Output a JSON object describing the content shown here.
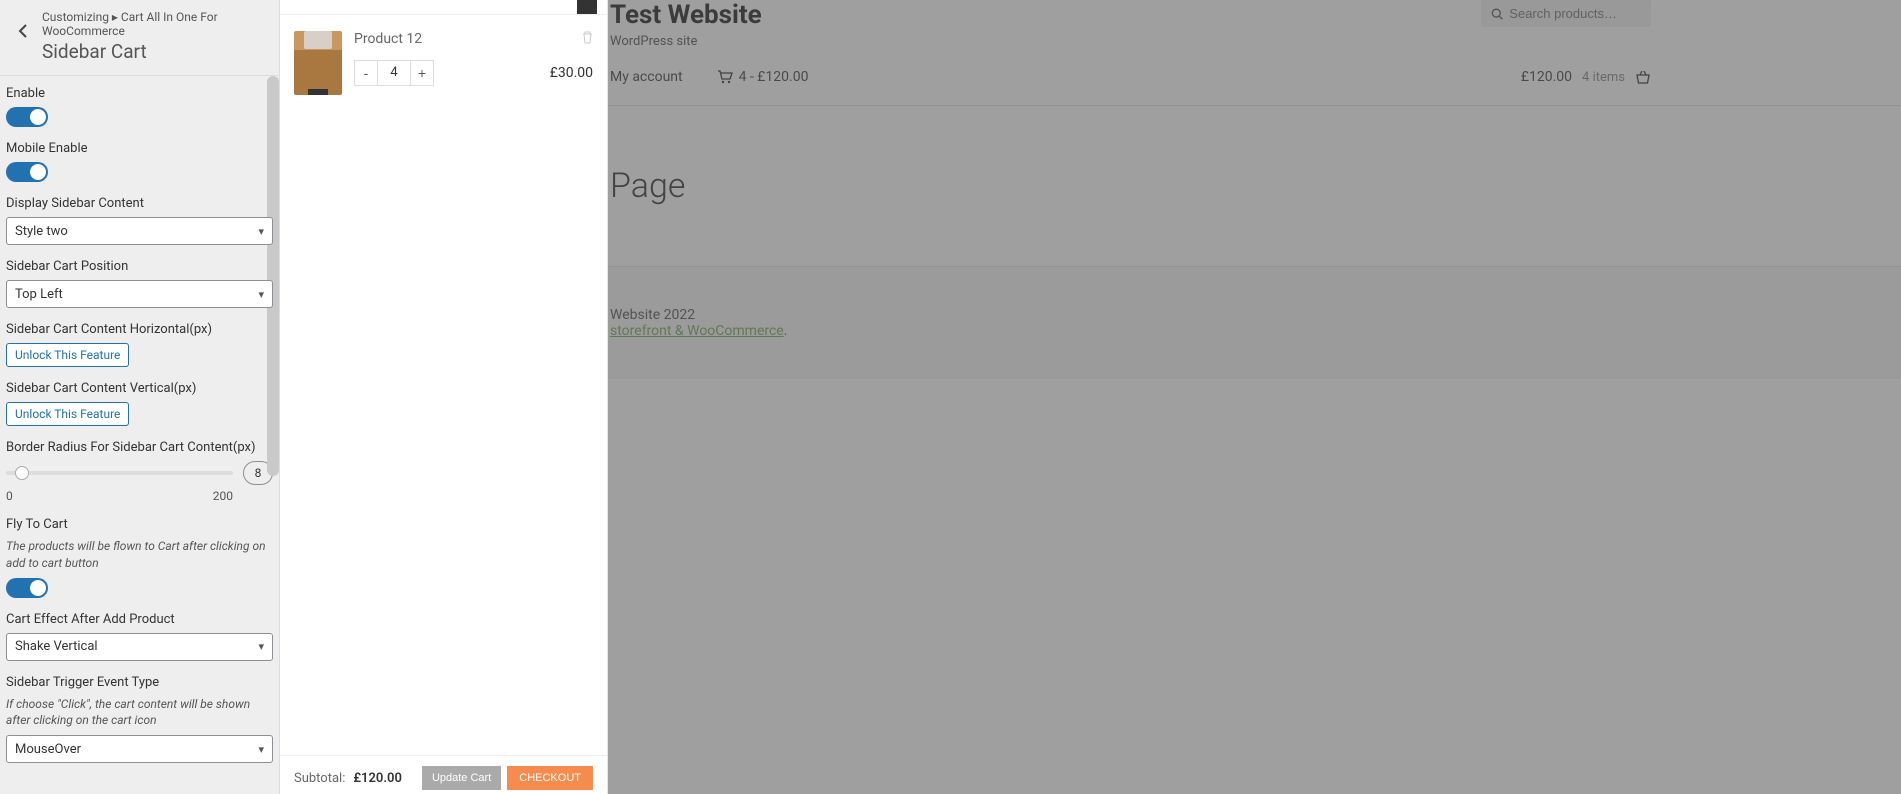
{
  "customizer": {
    "breadcrumb": "Customizing ▸ Cart All In One For WooCommerce",
    "title": "Sidebar Cart",
    "controls": {
      "enable": {
        "label": "Enable"
      },
      "mobile_enable": {
        "label": "Mobile Enable"
      },
      "display_sidebar_content": {
        "label": "Display Sidebar Content",
        "value": "Style two"
      },
      "sidebar_cart_position": {
        "label": "Sidebar Cart Position",
        "value": "Top Left"
      },
      "horizontal": {
        "label": "Sidebar Cart Content Horizontal(px)",
        "unlock": "Unlock This Feature"
      },
      "vertical": {
        "label": "Sidebar Cart Content Vertical(px)",
        "unlock": "Unlock This Feature"
      },
      "border_radius": {
        "label": "Border Radius For Sidebar Cart Content(px)",
        "value": "8",
        "min": "0",
        "max": "200"
      },
      "fly_to_cart": {
        "label": "Fly To Cart",
        "desc": "The products will be flown to Cart after clicking on add to cart button"
      },
      "cart_effect": {
        "label": "Cart Effect After Add Product",
        "value": "Shake Vertical"
      },
      "trigger": {
        "label": "Sidebar Trigger Event Type",
        "desc": "If choose \"Click\", the cart content will be shown after clicking on the cart icon",
        "value": "MouseOver"
      }
    }
  },
  "cart_panel": {
    "item": {
      "name": "Product 12",
      "qty": "4",
      "price": "£30.00"
    },
    "subtotal_label": "Subtotal:",
    "subtotal_value": "£120.00",
    "update_btn": "Update Cart",
    "checkout_btn": "CHECKOUT"
  },
  "site": {
    "title": "Test Website",
    "tagline": "WordPress site",
    "search_placeholder": "Search products…",
    "nav": {
      "account": "My account",
      "mini_cart": "4 - £120.00",
      "total": "£120.00",
      "items": "4 items"
    },
    "page_heading": "Page",
    "footer_line1": "Website 2022",
    "footer_link": "storefront & WooCommerce",
    "footer_period": "."
  }
}
